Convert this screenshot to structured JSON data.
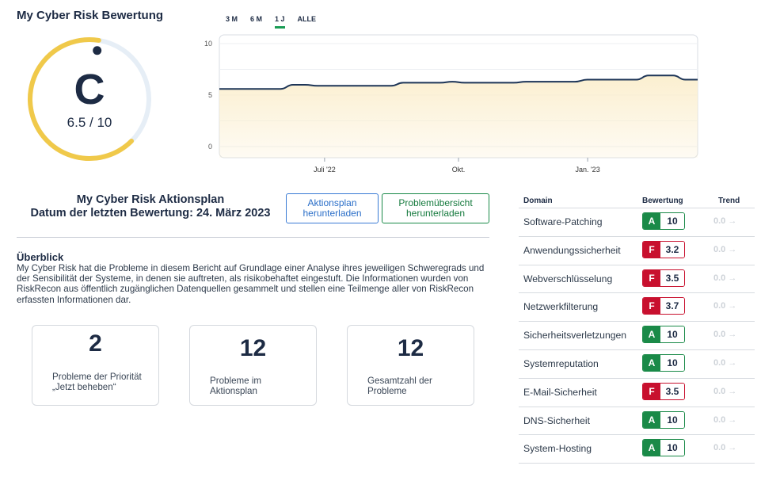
{
  "page": {
    "title": "My Cyber Risk Bewertung"
  },
  "gauge": {
    "grade": "C",
    "score_text": "6.5 / 10",
    "score": 6.5,
    "max": 10,
    "color": "#f0c94a",
    "track_color": "#e6eef6"
  },
  "ranges": [
    {
      "label": "3 M",
      "active": false
    },
    {
      "label": "6 M",
      "active": false
    },
    {
      "label": "1 J",
      "active": true
    },
    {
      "label": "ALLE",
      "active": false
    }
  ],
  "chart_data": {
    "type": "area",
    "y_ticks": [
      "10",
      "5",
      "0"
    ],
    "ylim": [
      0,
      10
    ],
    "x_ticks": [
      {
        "label": "Juli '22",
        "t": 0.22
      },
      {
        "label": "Okt.",
        "t": 0.5
      },
      {
        "label": "Jan. '23",
        "t": 0.77
      }
    ],
    "values": [
      5.6,
      5.6,
      5.6,
      5.6,
      5.6,
      5.6,
      6.0,
      6.0,
      5.9,
      5.9,
      5.9,
      5.9,
      5.9,
      5.9,
      5.9,
      6.2,
      6.2,
      6.2,
      6.2,
      6.3,
      6.2,
      6.2,
      6.2,
      6.2,
      6.2,
      6.3,
      6.3,
      6.3,
      6.3,
      6.3,
      6.5,
      6.5,
      6.5,
      6.5,
      6.5,
      6.9,
      6.9,
      6.9,
      6.5,
      6.5
    ],
    "line_color": "#1d3557",
    "fill_color": "#fbefd0"
  },
  "plan": {
    "title": "My Cyber Risk Aktionsplan",
    "date_line": "Datum der letzten Bewertung: 24. März 2023"
  },
  "buttons": {
    "download_plan": "Aktionsplan herunterladen",
    "download_overview": "Problemübersicht herunterladen"
  },
  "overview": {
    "heading": "Überblick",
    "text": "My Cyber Risk hat die Probleme in diesem Bericht auf Grundlage einer Analyse ihres jeweiligen Schweregrads und der Sensibilität der Systeme, in denen sie auftreten, als risikobehaftet eingestuft. Die Informationen wurden von RiskRecon aus öffentlich zugänglichen Datenquellen gesammelt und stellen eine Teilmenge aller von RiskRecon erfassten Informationen dar."
  },
  "stats": [
    {
      "value": "2",
      "label": "Probleme der Priorität „Jetzt beheben“"
    },
    {
      "value": "12",
      "label": "Probleme im Aktionsplan"
    },
    {
      "value": "12",
      "label": "Gesamtzahl der Probleme"
    }
  ],
  "table": {
    "headers": {
      "domain": "Domain",
      "rating": "Bewertung",
      "trend": "Trend"
    },
    "rows": [
      {
        "domain": "Software-Patching",
        "grade": "A",
        "score": "10",
        "trend": "0.0 →"
      },
      {
        "domain": "Anwendungssicherheit",
        "grade": "F",
        "score": "3.2",
        "trend": "0.0 →"
      },
      {
        "domain": "Webverschlüsselung",
        "grade": "F",
        "score": "3.5",
        "trend": "0.0 →"
      },
      {
        "domain": "Netzwerkfilterung",
        "grade": "F",
        "score": "3.7",
        "trend": "0.0 →"
      },
      {
        "domain": "Sicherheitsverletzungen",
        "grade": "A",
        "score": "10",
        "trend": "0.0 →"
      },
      {
        "domain": "Systemreputation",
        "grade": "A",
        "score": "10",
        "trend": "0.0 →"
      },
      {
        "domain": "E-Mail-Sicherheit",
        "grade": "F",
        "score": "3.5",
        "trend": "0.0 →"
      },
      {
        "domain": "DNS-Sicherheit",
        "grade": "A",
        "score": "10",
        "trend": "0.0 →"
      },
      {
        "domain": "System-Hosting",
        "grade": "A",
        "score": "10",
        "trend": "0.0 →"
      }
    ],
    "grade_colors": {
      "A": "#1a8a48",
      "F": "#c8102e"
    }
  }
}
